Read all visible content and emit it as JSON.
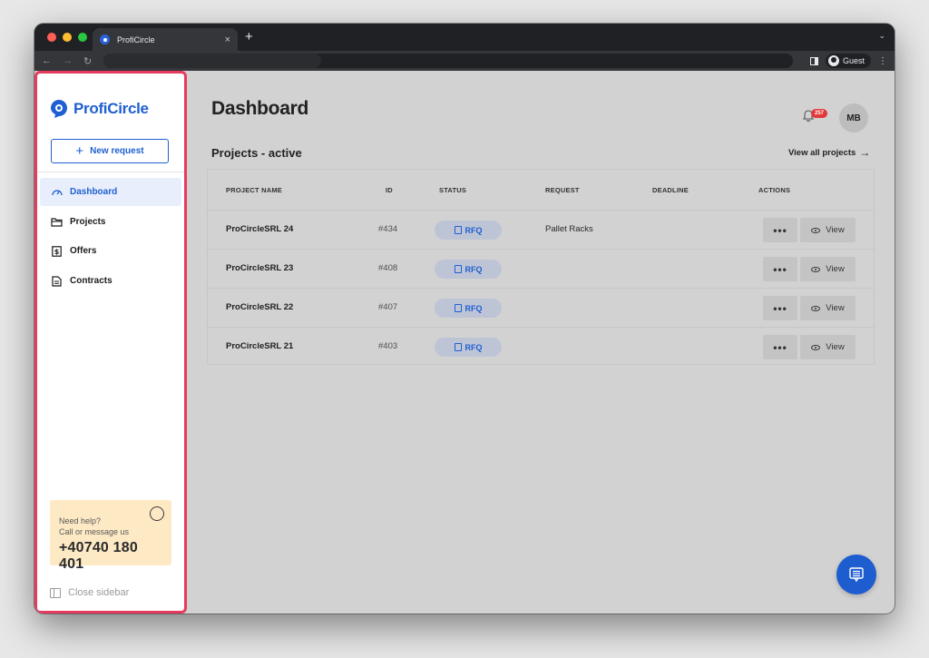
{
  "browser": {
    "tab_title": "ProfiCircle",
    "tab_close": "×",
    "new_tab": "+",
    "profile_label": "Guest",
    "colors": {
      "frame": "#202124",
      "toolbar": "#35363a"
    }
  },
  "sidebar": {
    "logo_text": "ProfiCircle",
    "new_request_label": "New request",
    "items": [
      {
        "label": "Dashboard",
        "icon": "gauge-icon",
        "active": true
      },
      {
        "label": "Projects",
        "icon": "folder-icon",
        "active": false
      },
      {
        "label": "Offers",
        "icon": "dollar-icon",
        "active": false
      },
      {
        "label": "Contracts",
        "icon": "document-icon",
        "active": false
      }
    ],
    "help": {
      "line1": "Need help?",
      "line2": "Call or message us",
      "phone": "+40740 180 401",
      "icon": "whatsapp-icon"
    },
    "close_label": "Close sidebar",
    "colors": {
      "accent": "#1f5fd1",
      "highlight_border": "#e63b5e",
      "help_bg": "#fde9c4"
    }
  },
  "main": {
    "title": "Dashboard",
    "notifications_count": "257",
    "avatar_initials": "MB",
    "section_title": "Projects - active",
    "view_all_label": "View all projects",
    "view_all_arrow": "→",
    "table": {
      "headers": [
        "PROJECT NAME",
        "ID",
        "STATUS",
        "REQUEST",
        "DEADLINE",
        "ACTIONS"
      ],
      "rows": [
        {
          "name": "ProCircleSRL 24",
          "id": "#434",
          "status": "RFQ",
          "request": "Pallet Racks",
          "deadline": ""
        },
        {
          "name": "ProCircleSRL 23",
          "id": "#408",
          "status": "RFQ",
          "request": "",
          "deadline": ""
        },
        {
          "name": "ProCircleSRL 22",
          "id": "#407",
          "status": "RFQ",
          "request": "",
          "deadline": ""
        },
        {
          "name": "ProCircleSRL 21",
          "id": "#403",
          "status": "RFQ",
          "request": "",
          "deadline": ""
        }
      ],
      "more_label": "•••",
      "view_label": "View"
    },
    "colors": {
      "badge": "#e23a3a",
      "status_pill": "#bdc4d6",
      "fab": "#1e5dd0"
    }
  }
}
